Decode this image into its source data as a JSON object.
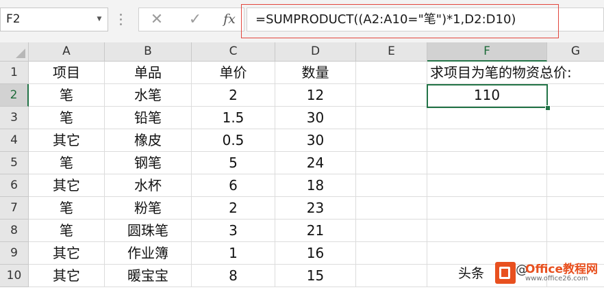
{
  "namebox": {
    "value": "F2"
  },
  "formula_bar": {
    "cancel_icon": "✕",
    "enter_icon": "✓",
    "fx_label": "fx",
    "formula": "=SUMPRODUCT((A2:A10=\"笔\")*1,D2:D10)"
  },
  "columns": [
    "A",
    "B",
    "C",
    "D",
    "E",
    "F",
    "G"
  ],
  "rows": [
    "1",
    "2",
    "3",
    "4",
    "5",
    "6",
    "7",
    "8",
    "9",
    "10"
  ],
  "cells": {
    "header": [
      "项目",
      "单品",
      "单价",
      "数量"
    ],
    "data": [
      [
        "笔",
        "水笔",
        "2",
        "12"
      ],
      [
        "笔",
        "铅笔",
        "1.5",
        "30"
      ],
      [
        "其它",
        "橡皮",
        "0.5",
        "30"
      ],
      [
        "笔",
        "钢笔",
        "5",
        "24"
      ],
      [
        "其它",
        "水杯",
        "6",
        "18"
      ],
      [
        "笔",
        "粉笔",
        "2",
        "23"
      ],
      [
        "笔",
        "圆珠笔",
        "3",
        "21"
      ],
      [
        "其它",
        "作业簿",
        "1",
        "16"
      ],
      [
        "其它",
        "暖宝宝",
        "8",
        "15"
      ]
    ],
    "f1_label": "求项目为笔的物资总价:",
    "f2_result": "110"
  },
  "selection": {
    "active_column": "F",
    "active_row": "2"
  },
  "watermark": {
    "prefix": "头条",
    "tail": "@",
    "brand": "Office教程网",
    "url": "www.office26.com"
  },
  "colors": {
    "selection_border": "#217346",
    "formula_highlight": "#e2453c",
    "brand_orange": "#e8501f"
  }
}
